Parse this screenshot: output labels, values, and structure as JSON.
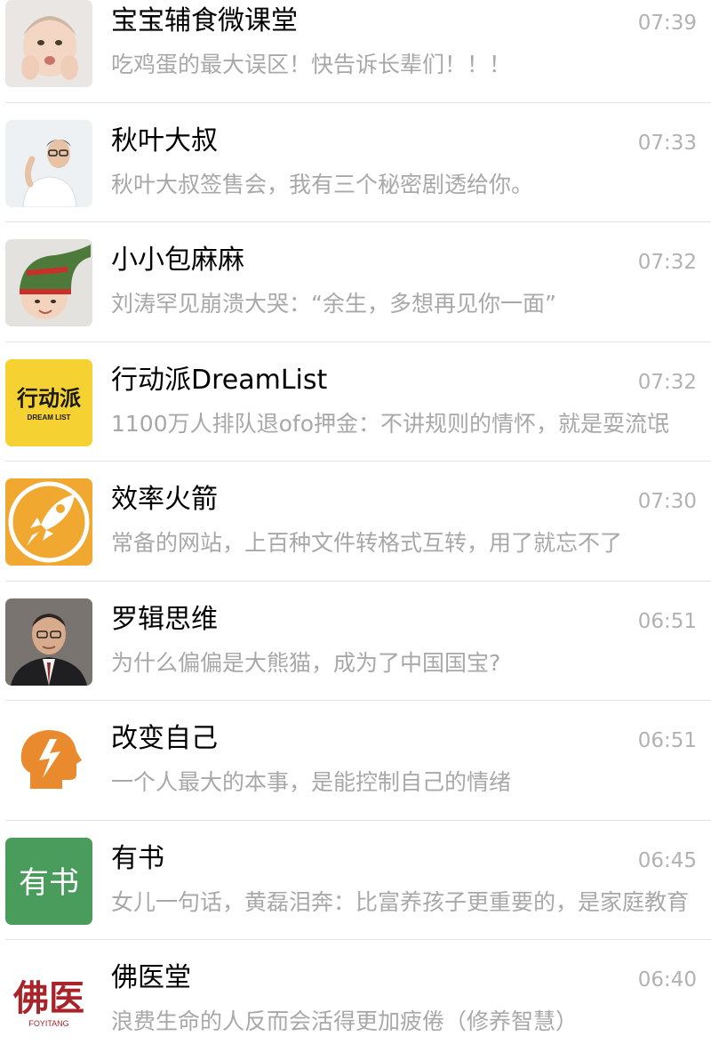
{
  "conversations": [
    {
      "name": "宝宝辅食微课堂",
      "preview": "吃鸡蛋的最大误区！快告诉长辈们！！！",
      "time": "07:39"
    },
    {
      "name": "秋叶大叔",
      "preview": "秋叶大叔签售会，我有三个秘密剧透给你。",
      "time": "07:33"
    },
    {
      "name": "小小包麻麻",
      "preview": "刘涛罕见崩溃大哭：“余生，多想再见你一面”",
      "time": "07:32"
    },
    {
      "name": "行动派DreamList",
      "preview": "1100万人排队退ofo押金：不讲规则的情怀，就是耍流氓",
      "time": "07:32",
      "logo_text": "行动派",
      "logo_subtext": "DREAM LIST"
    },
    {
      "name": "效率火箭",
      "preview": "常备的网站，上百种文件转格式互转，用了就忘不了",
      "time": "07:30"
    },
    {
      "name": "罗辑思维",
      "preview": "为什么偏偏是大熊猫，成为了中国国宝?",
      "time": "06:51"
    },
    {
      "name": "改变自己",
      "preview": "一个人最大的本事，是能控制自己的情绪",
      "time": "06:51"
    },
    {
      "name": "有书",
      "preview": "女儿一句话，黄磊泪奔：比富养孩子更重要的，是家庭教育",
      "time": "06:45",
      "logo_text": "有书"
    },
    {
      "name": "佛医堂",
      "preview": "浪费生命的人反而会活得更加疲倦（修养智慧）",
      "time": "06:40",
      "logo_text": "佛医",
      "logo_subtext": "FOYITANG"
    }
  ],
  "colors": {
    "name": "#000000",
    "preview": "#a8a8a8",
    "time": "#b2b2b2",
    "divider": "#e3e3e3",
    "dreamlist_bg": "#f5d132",
    "rocket_bg": "#f0a830",
    "youshu_bg": "#4a9c5d",
    "foyitang_red": "#a8242a",
    "change_orange": "#ea8a2e"
  },
  "icons": [
    "baby-photo-avatar",
    "man-glasses-photo-avatar",
    "baby-knit-hat-photo-avatar",
    "dreamlist-logo",
    "rocket-logo",
    "luoji-man-photo-avatar",
    "head-lightning-logo",
    "youshu-logo",
    "foyitang-logo"
  ]
}
